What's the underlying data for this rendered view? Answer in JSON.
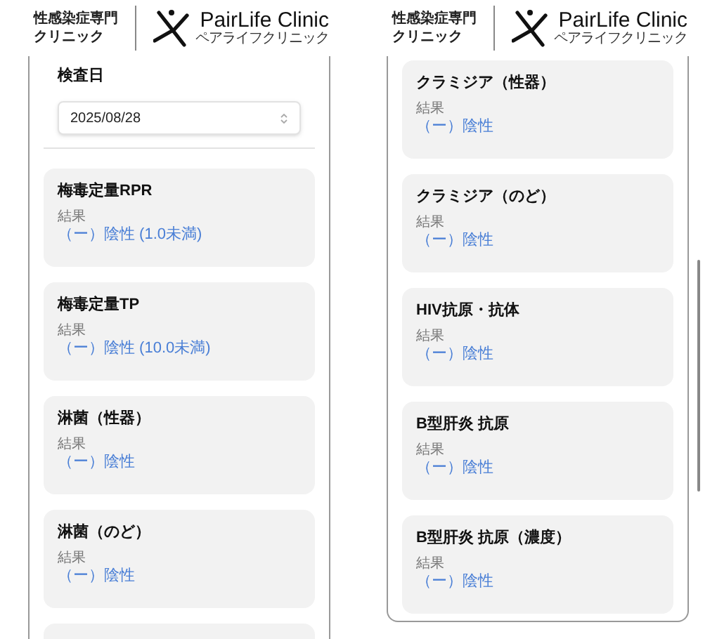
{
  "screens": [
    {
      "header": {
        "tagline": "性感染症専門",
        "tagline_2": "クリニック",
        "brand": "PairLife Clinic",
        "brand_kana": "ペアライフクリニック"
      },
      "date_field": {
        "label": "検査日",
        "value": "2025/08/28"
      },
      "results": [
        {
          "test": "梅毒定量RPR",
          "label": "結果",
          "value": "（ー）陰性 (1.0未満)"
        },
        {
          "test": "梅毒定量TP",
          "label": "結果",
          "value": "（ー）陰性 (10.0未満)"
        },
        {
          "test": "淋菌（性器）",
          "label": "結果",
          "value": "（ー）陰性"
        },
        {
          "test": "淋菌（のど）",
          "label": "結果",
          "value": "（ー）陰性"
        }
      ],
      "more_below": true,
      "scrollbar": false
    },
    {
      "header": {
        "tagline": "性感染症専門",
        "tagline_2": "クリニック",
        "brand": "PairLife Clinic",
        "brand_kana": "ペアライフクリニック"
      },
      "results": [
        {
          "test": "クラミジア（性器）",
          "label": "結果",
          "value": "（ー）陰性"
        },
        {
          "test": "クラミジア（のど）",
          "label": "結果",
          "value": "（ー）陰性"
        },
        {
          "test": "HIV抗原・抗体",
          "label": "結果",
          "value": "（ー）陰性"
        },
        {
          "test": "B型肝炎 抗原",
          "label": "結果",
          "value": "（ー）陰性"
        },
        {
          "test": "B型肝炎 抗原（濃度）",
          "label": "結果",
          "value": "（ー）陰性"
        }
      ],
      "more_below": false,
      "scrollbar": true
    }
  ]
}
